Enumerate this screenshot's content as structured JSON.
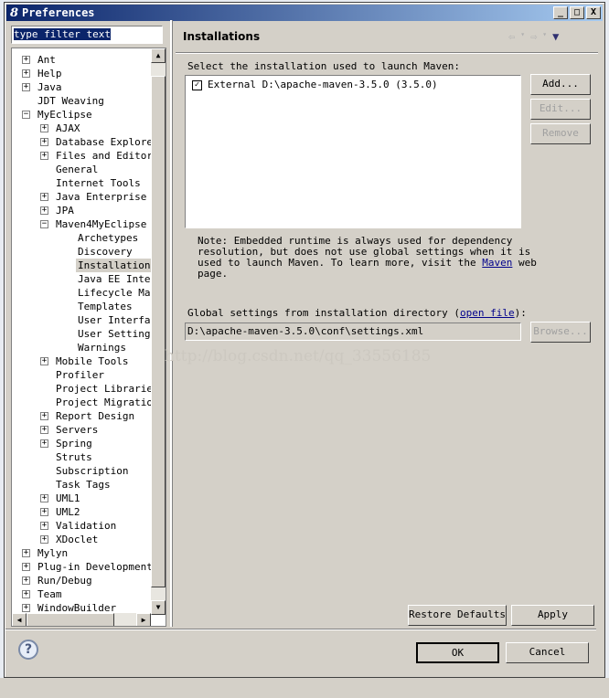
{
  "window": {
    "title": "Preferences",
    "minimize": "_",
    "maximize": "□",
    "close": "X"
  },
  "filter": {
    "value": "type filter text"
  },
  "tree": [
    {
      "label": "Ant",
      "level": 0,
      "expander": "+"
    },
    {
      "label": "Help",
      "level": 0,
      "expander": "+"
    },
    {
      "label": "Java",
      "level": 0,
      "expander": "+"
    },
    {
      "label": "JDT Weaving",
      "level": 0,
      "expander": ""
    },
    {
      "label": "MyEclipse",
      "level": 0,
      "expander": "-"
    },
    {
      "label": "AJAX",
      "level": 1,
      "expander": "+"
    },
    {
      "label": "Database Explorer",
      "level": 1,
      "expander": "+"
    },
    {
      "label": "Files and Editors",
      "level": 1,
      "expander": "+"
    },
    {
      "label": "General",
      "level": 1,
      "expander": ""
    },
    {
      "label": "Internet Tools",
      "level": 1,
      "expander": ""
    },
    {
      "label": "Java Enterprise Pr",
      "level": 1,
      "expander": "+"
    },
    {
      "label": "JPA",
      "level": 1,
      "expander": "+"
    },
    {
      "label": "Maven4MyEclipse",
      "level": 1,
      "expander": "-"
    },
    {
      "label": "Archetypes",
      "level": 2,
      "expander": ""
    },
    {
      "label": "Discovery",
      "level": 2,
      "expander": ""
    },
    {
      "label": "Installations",
      "level": 2,
      "expander": "",
      "selected": true
    },
    {
      "label": "Java EE Integra",
      "level": 2,
      "expander": ""
    },
    {
      "label": "Lifecycle Mappi",
      "level": 2,
      "expander": ""
    },
    {
      "label": "Templates",
      "level": 2,
      "expander": ""
    },
    {
      "label": "User Interface",
      "level": 2,
      "expander": ""
    },
    {
      "label": "User Settings",
      "level": 2,
      "expander": ""
    },
    {
      "label": "Warnings",
      "level": 2,
      "expander": ""
    },
    {
      "label": "Mobile Tools",
      "level": 1,
      "expander": "+"
    },
    {
      "label": "Profiler",
      "level": 1,
      "expander": ""
    },
    {
      "label": "Project Libraries",
      "level": 1,
      "expander": ""
    },
    {
      "label": "Project Migration",
      "level": 1,
      "expander": ""
    },
    {
      "label": "Report Design",
      "level": 1,
      "expander": "+"
    },
    {
      "label": "Servers",
      "level": 1,
      "expander": "+"
    },
    {
      "label": "Spring",
      "level": 1,
      "expander": "+"
    },
    {
      "label": "Struts",
      "level": 1,
      "expander": ""
    },
    {
      "label": "Subscription",
      "level": 1,
      "expander": ""
    },
    {
      "label": "Task Tags",
      "level": 1,
      "expander": ""
    },
    {
      "label": "UML1",
      "level": 1,
      "expander": "+"
    },
    {
      "label": "UML2",
      "level": 1,
      "expander": "+"
    },
    {
      "label": "Validation",
      "level": 1,
      "expander": "+"
    },
    {
      "label": "XDoclet",
      "level": 1,
      "expander": "+"
    },
    {
      "label": "Mylyn",
      "level": 0,
      "expander": "+"
    },
    {
      "label": "Plug-in Development",
      "level": 0,
      "expander": "+"
    },
    {
      "label": "Run/Debug",
      "level": 0,
      "expander": "+"
    },
    {
      "label": "Team",
      "level": 0,
      "expander": "+"
    },
    {
      "label": "WindowBuilder",
      "level": 0,
      "expander": "+"
    }
  ],
  "page": {
    "title": "Installations",
    "select_label": "Select the installation used to launch Maven:",
    "installations": [
      {
        "label": "External D:\\apache-maven-3.5.0 (3.5.0)",
        "checked": true
      }
    ],
    "add": "Add...",
    "edit": "Edit...",
    "remove": "Remove",
    "note_lines": [
      "Note: Embedded runtime is always used for dependency",
      "resolution, but does not use global settings when it is",
      "used to launch Maven. To learn more, visit the "
    ],
    "note_link": "Maven",
    "note_tail": " web",
    "note_last": "page.",
    "global_label": "Global settings from installation directory (",
    "global_link": "open file",
    "global_tail": "):",
    "global_path": "D:\\apache-maven-3.5.0\\conf\\settings.xml",
    "browse": "Browse...",
    "restore": "Restore Defaults",
    "apply": "Apply"
  },
  "watermark": "http://blog.csdn.net/qq_33556185",
  "footer": {
    "ok": "OK",
    "cancel": "Cancel"
  }
}
